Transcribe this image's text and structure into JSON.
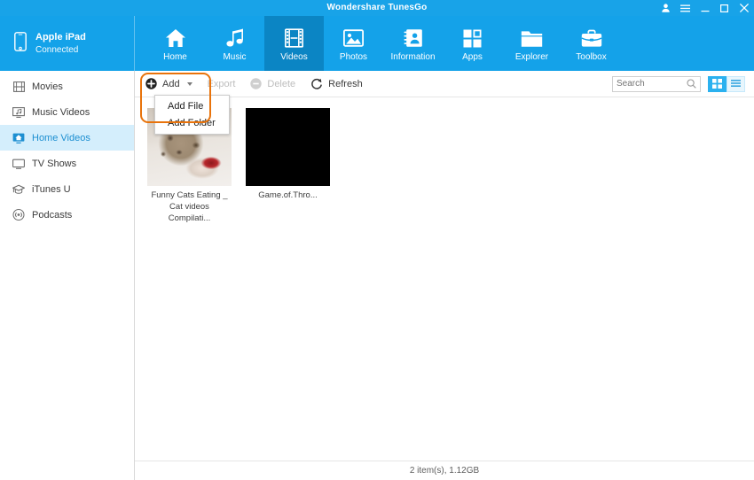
{
  "window": {
    "title": "Wondershare TunesGo",
    "controls": [
      {
        "name": "account-icon",
        "label": "Account"
      },
      {
        "name": "menu-icon",
        "label": "Menu"
      },
      {
        "name": "minimize-icon",
        "label": "Minimize"
      },
      {
        "name": "maximize-icon",
        "label": "Maximize"
      },
      {
        "name": "close-icon",
        "label": "Close"
      }
    ]
  },
  "device": {
    "name": "Apple iPad",
    "status": "Connected",
    "icon": "phone-icon"
  },
  "nav": {
    "tabs": [
      {
        "label": "Home",
        "icon": "home-icon",
        "active": false
      },
      {
        "label": "Music",
        "icon": "music-note-icon",
        "active": false
      },
      {
        "label": "Videos",
        "icon": "film-strip-icon",
        "active": true
      },
      {
        "label": "Photos",
        "icon": "picture-icon",
        "active": false
      },
      {
        "label": "Information",
        "icon": "contact-card-icon",
        "active": false
      },
      {
        "label": "Apps",
        "icon": "apps-grid-icon",
        "active": false
      },
      {
        "label": "Explorer",
        "icon": "folder-icon",
        "active": false
      },
      {
        "label": "Toolbox",
        "icon": "briefcase-icon",
        "active": false
      }
    ]
  },
  "sidebar": {
    "items": [
      {
        "label": "Movies",
        "icon": "movie-icon",
        "active": false
      },
      {
        "label": "Music Videos",
        "icon": "music-video-icon",
        "active": false
      },
      {
        "label": "Home Videos",
        "icon": "home-video-icon",
        "active": true
      },
      {
        "label": "TV Shows",
        "icon": "tv-icon",
        "active": false
      },
      {
        "label": "iTunes U",
        "icon": "graduation-cap-icon",
        "active": false
      },
      {
        "label": "Podcasts",
        "icon": "podcast-icon",
        "active": false
      }
    ]
  },
  "toolbar": {
    "add_label": "Add",
    "export_label": "Export",
    "delete_label": "Delete",
    "refresh_label": "Refresh",
    "add_enabled": true,
    "export_enabled": false,
    "delete_enabled": false,
    "refresh_enabled": true,
    "dropdown": {
      "open": true,
      "items": [
        {
          "label": "Add File"
        },
        {
          "label": "Add Folder"
        }
      ]
    },
    "highlight_color": "#e8730b"
  },
  "search": {
    "placeholder": "Search",
    "value": ""
  },
  "view": {
    "grid_label": "Grid view",
    "list_label": "List view",
    "active": "grid",
    "accent": "#2bb1ef"
  },
  "content": {
    "items": [
      {
        "caption": "Funny Cats Eating _ Cat videos Compilati...",
        "thumb": "cat-photo"
      },
      {
        "caption": "Game.of.Thro...",
        "thumb": "black-frame"
      }
    ]
  },
  "status": {
    "text": "2 item(s), 1.12GB"
  },
  "colors": {
    "header_blue": "#14a2e9",
    "title_blue": "#18a3e8",
    "active_tab_blue": "#0b85c4",
    "sidebar_active_bg": "#d4eefc",
    "sidebar_active_text": "#1d8fd1"
  }
}
